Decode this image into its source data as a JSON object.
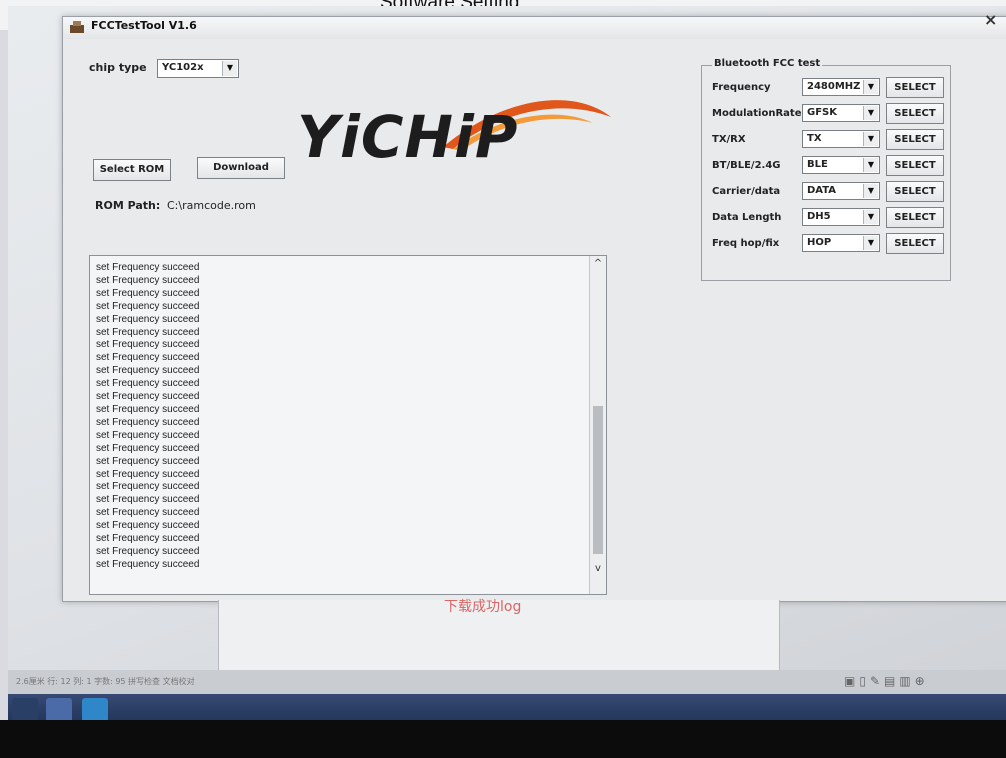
{
  "document": {
    "title": "Software Setting",
    "body_text": "下载成功log"
  },
  "window": {
    "title": "FCCTestTool V1.6",
    "close": "×"
  },
  "chip": {
    "label": "chip type",
    "value": "YC102x"
  },
  "buttons": {
    "select_rom": "Select ROM",
    "download": "Download"
  },
  "rom": {
    "label": "ROM Path:",
    "value": "C:\\ramcode.rom"
  },
  "logo": {
    "text": "YiCHiP"
  },
  "fcc": {
    "title": "Bluetooth FCC test",
    "rows": [
      {
        "label": "Frequency",
        "value": "2480MHZ",
        "button": "SELECT"
      },
      {
        "label": "ModulationRate",
        "value": "GFSK",
        "button": "SELECT"
      },
      {
        "label": "TX/RX",
        "value": "TX",
        "button": "SELECT"
      },
      {
        "label": "BT/BLE/2.4G",
        "value": "BLE",
        "button": "SELECT"
      },
      {
        "label": "Carrier/data",
        "value": "DATA",
        "button": "SELECT"
      },
      {
        "label": "Data Length",
        "value": "DH5",
        "button": "SELECT"
      },
      {
        "label": "Freq hop/fix",
        "value": "HOP",
        "button": "SELECT"
      }
    ]
  },
  "log": {
    "lines": [
      "set Frequency succeed",
      "set Frequency succeed",
      "set Frequency succeed",
      "set Frequency succeed",
      "set Frequency succeed",
      "set Frequency succeed",
      "set Frequency succeed",
      "set Frequency succeed",
      "set Frequency succeed",
      "set Frequency succeed",
      "set Frequency succeed",
      "set Frequency succeed",
      "set Frequency succeed",
      "set Frequency succeed",
      "set Frequency succeed",
      "set Frequency succeed",
      "set Frequency succeed",
      "set Frequency succeed",
      "set Frequency succeed",
      "set Frequency succeed",
      "set Frequency succeed",
      "set Frequency succeed",
      "set Frequency succeed",
      "set Frequency succeed"
    ]
  },
  "statusbar": {
    "text": "2.6厘米  行: 12  列: 1  字数: 95  拼写检查  文档校对"
  },
  "icons": {
    "app": "app-icon",
    "close": "close-icon",
    "dropdown": "chevron-down-icon",
    "scroll_up": "chevron-up-icon",
    "scroll_down": "chevron-down-icon"
  }
}
